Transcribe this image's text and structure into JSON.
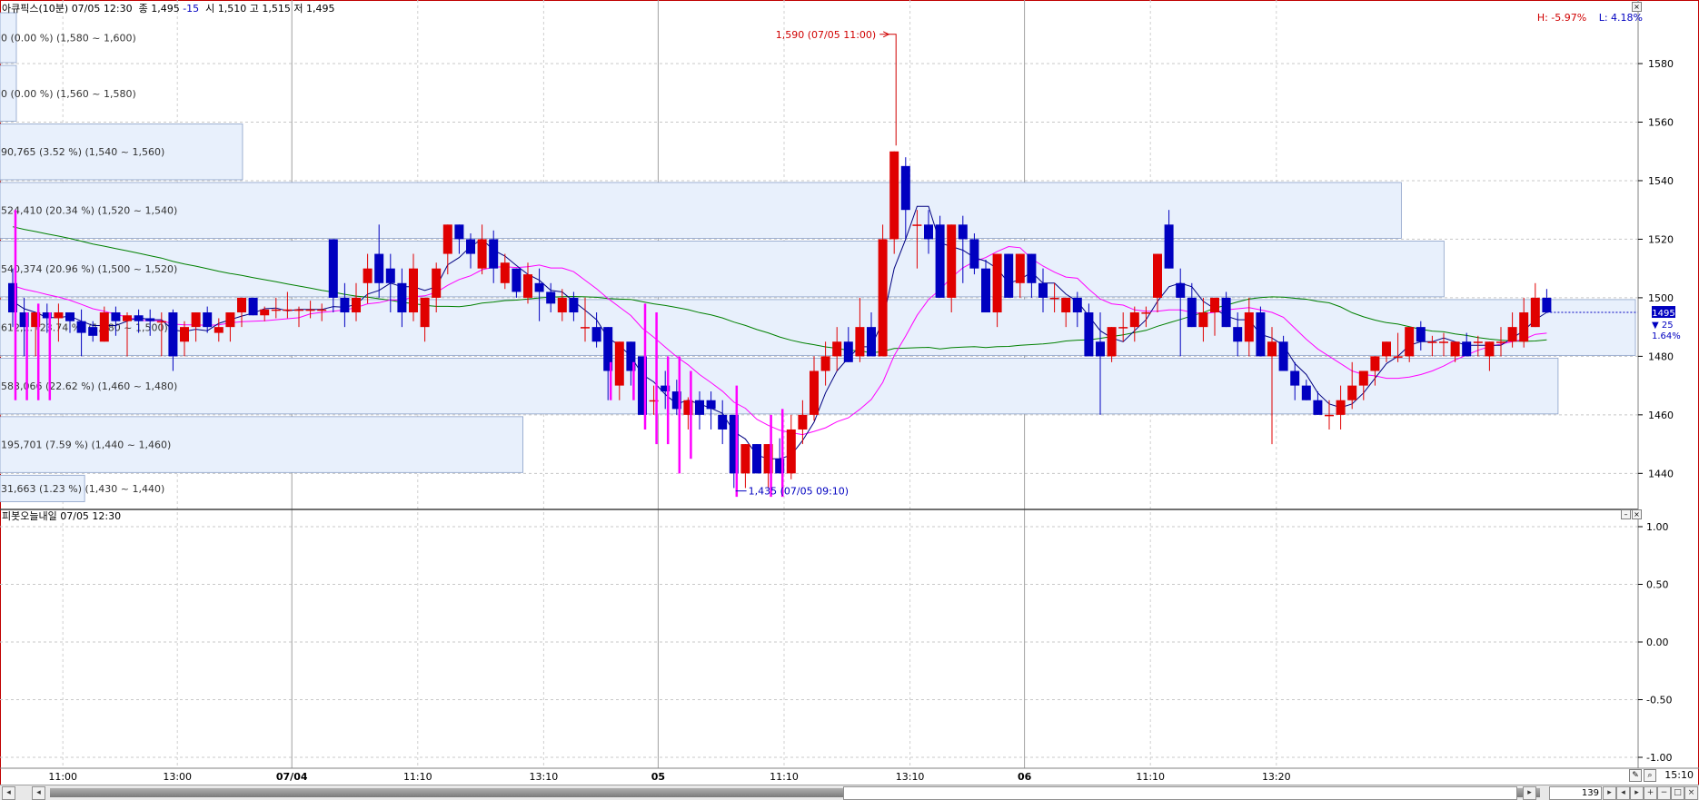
{
  "header": {
    "symbol": "아큐픽스(10분)",
    "datetime": "07/05 12:30",
    "close_label": "종 1,495",
    "change": "-15",
    "ohl": "시 1,510 고 1,515 저 1,495"
  },
  "hilo": {
    "high": "H: -5.97%",
    "low": "L: 4.18%"
  },
  "indicator": {
    "title": "피봇오늘내일",
    "datetime": "07/05 12:30"
  },
  "annotations": {
    "max_label": "1,590 (07/05 11:00)",
    "min_label": "1,435 (07/05 09:10)"
  },
  "price_axis": {
    "ticks": [
      "1580",
      "1560",
      "1540",
      "1520",
      "1500",
      "1480",
      "1460",
      "1440"
    ],
    "current": "1495",
    "change": "▼ 25",
    "pct": "1.64%"
  },
  "indicator_axis": {
    "ticks": [
      "1.00",
      "0.50",
      "0.00",
      "-0.50",
      "-1.00"
    ]
  },
  "time_axis": {
    "ticks": [
      "11:00",
      "13:00",
      "07/04",
      "11:10",
      "13:10",
      "05",
      "11:10",
      "13:10",
      "06",
      "11:10",
      "13:20"
    ]
  },
  "volume_profile": [
    {
      "label": "0 (0.00 %) (1,580 ~ 1,600)",
      "value": 0
    },
    {
      "label": "0 (0.00 %) (1,560 ~ 1,580)",
      "value": 0
    },
    {
      "label": "90,765 (3.52 %) (1,540 ~ 1,560)",
      "value": 90765
    },
    {
      "label": "524,410 (20.34 %) (1,520 ~ 1,540)",
      "value": 524410
    },
    {
      "label": "540,374 (20.96 %) (1,500 ~ 1,520)",
      "value": 540374
    },
    {
      "label": "612,... (23.74 %) (1,480 ~ 1,500)",
      "value": 612000
    },
    {
      "label": "583,066 (22.62 %) (1,460 ~ 1,480)",
      "value": 583066
    },
    {
      "label": "195,701 (7.59 %) (1,440 ~ 1,460)",
      "value": 195701
    },
    {
      "label": "31,663 (1.23 %) (1,430 ~ 1,440)",
      "value": 31663
    }
  ],
  "bottom": {
    "count": "139",
    "time": "15:10"
  },
  "colors": {
    "up": "#e00000",
    "down": "#0000c0",
    "ma_short": "#000080",
    "ma_mid": "#ff00ff",
    "ma_long": "#008000",
    "profile_fill": "#e8f0fc",
    "profile_border": "#8aa0c8"
  },
  "chart_data": {
    "type": "candlestick",
    "y_range": [
      1428,
      1598
    ],
    "candles": [
      [
        1505,
        1510,
        1490,
        1495
      ],
      [
        1495,
        1500,
        1480,
        1490
      ],
      [
        1490,
        1495,
        1480,
        1495
      ],
      [
        1495,
        1498,
        1488,
        1493
      ],
      [
        1493,
        1498,
        1485,
        1495
      ],
      [
        1495,
        1495,
        1488,
        1492
      ],
      [
        1492,
        1496,
        1480,
        1488
      ],
      [
        1490,
        1492,
        1485,
        1487
      ],
      [
        1485,
        1497,
        1485,
        1495
      ],
      [
        1495,
        1497,
        1487,
        1492
      ],
      [
        1492,
        1495,
        1480,
        1494
      ],
      [
        1494,
        1496,
        1488,
        1492
      ],
      [
        1493,
        1496,
        1487,
        1492
      ],
      [
        1492,
        1495,
        1480,
        1492
      ],
      [
        1495,
        1496,
        1475,
        1480
      ],
      [
        1485,
        1492,
        1480,
        1490
      ],
      [
        1490,
        1495,
        1485,
        1495
      ],
      [
        1495,
        1497,
        1488,
        1490
      ],
      [
        1488,
        1493,
        1485,
        1490
      ],
      [
        1490,
        1495,
        1485,
        1495
      ],
      [
        1495,
        1500,
        1490,
        1500
      ],
      [
        1500,
        1500,
        1494,
        1494
      ],
      [
        1494,
        1497,
        1492,
        1496
      ],
      [
        1496,
        1500,
        1493,
        1496
      ],
      [
        1496,
        1502,
        1493,
        1496
      ],
      [
        1496,
        1497,
        1490,
        1496
      ],
      [
        1496,
        1499,
        1493,
        1496
      ],
      [
        1496,
        1498,
        1492,
        1496
      ],
      [
        1520,
        1520,
        1495,
        1500
      ],
      [
        1500,
        1505,
        1490,
        1495
      ],
      [
        1495,
        1505,
        1492,
        1500
      ],
      [
        1505,
        1515,
        1498,
        1510
      ],
      [
        1515,
        1525,
        1500,
        1505
      ],
      [
        1510,
        1515,
        1495,
        1505
      ],
      [
        1505,
        1510,
        1490,
        1495
      ],
      [
        1495,
        1515,
        1492,
        1510
      ],
      [
        1490,
        1500,
        1485,
        1500
      ],
      [
        1500,
        1512,
        1495,
        1510
      ],
      [
        1515,
        1525,
        1508,
        1525
      ],
      [
        1525,
        1525,
        1515,
        1520
      ],
      [
        1520,
        1522,
        1510,
        1515
      ],
      [
        1510,
        1525,
        1508,
        1520
      ],
      [
        1520,
        1523,
        1505,
        1510
      ],
      [
        1505,
        1515,
        1503,
        1512
      ],
      [
        1510,
        1510,
        1500,
        1502
      ],
      [
        1500,
        1512,
        1498,
        1508
      ],
      [
        1505,
        1510,
        1492,
        1502
      ],
      [
        1502,
        1505,
        1495,
        1498
      ],
      [
        1495,
        1503,
        1492,
        1500
      ],
      [
        1500,
        1502,
        1492,
        1495
      ],
      [
        1490,
        1500,
        1485,
        1490
      ],
      [
        1490,
        1495,
        1483,
        1485
      ],
      [
        1490,
        1490,
        1465,
        1475
      ],
      [
        1470,
        1485,
        1465,
        1485
      ],
      [
        1485,
        1485,
        1470,
        1475
      ],
      [
        1480,
        1480,
        1460,
        1460
      ],
      [
        1465,
        1470,
        1460,
        1465
      ],
      [
        1470,
        1475,
        1462,
        1468
      ],
      [
        1468,
        1472,
        1460,
        1462
      ],
      [
        1460,
        1466,
        1455,
        1465
      ],
      [
        1465,
        1468,
        1455,
        1460
      ],
      [
        1465,
        1468,
        1455,
        1462
      ],
      [
        1460,
        1465,
        1450,
        1455
      ],
      [
        1460,
        1460,
        1435,
        1440
      ],
      [
        1440,
        1450,
        1435,
        1450
      ],
      [
        1450,
        1450,
        1440,
        1440
      ],
      [
        1440,
        1450,
        1435,
        1450
      ],
      [
        1445,
        1452,
        1440,
        1440
      ],
      [
        1440,
        1460,
        1438,
        1455
      ],
      [
        1455,
        1465,
        1450,
        1460
      ],
      [
        1460,
        1480,
        1458,
        1475
      ],
      [
        1475,
        1485,
        1470,
        1480
      ],
      [
        1480,
        1490,
        1475,
        1485
      ],
      [
        1485,
        1490,
        1478,
        1478
      ],
      [
        1480,
        1500,
        1478,
        1490
      ],
      [
        1490,
        1495,
        1480,
        1480
      ],
      [
        1480,
        1525,
        1480,
        1520
      ],
      [
        1520,
        1550,
        1515,
        1550
      ],
      [
        1545,
        1548,
        1520,
        1530
      ],
      [
        1525,
        1530,
        1510,
        1525
      ],
      [
        1525,
        1530,
        1515,
        1520
      ],
      [
        1525,
        1528,
        1500,
        1500
      ],
      [
        1500,
        1525,
        1495,
        1525
      ],
      [
        1525,
        1528,
        1505,
        1520
      ],
      [
        1520,
        1522,
        1508,
        1510
      ],
      [
        1510,
        1513,
        1495,
        1495
      ],
      [
        1495,
        1515,
        1490,
        1515
      ],
      [
        1515,
        1515,
        1500,
        1500
      ],
      [
        1505,
        1515,
        1500,
        1515
      ],
      [
        1515,
        1515,
        1500,
        1505
      ],
      [
        1505,
        1510,
        1495,
        1500
      ],
      [
        1500,
        1505,
        1495,
        1500
      ],
      [
        1495,
        1500,
        1490,
        1500
      ],
      [
        1500,
        1502,
        1490,
        1495
      ],
      [
        1495,
        1498,
        1480,
        1480
      ],
      [
        1485,
        1495,
        1460,
        1480
      ],
      [
        1480,
        1490,
        1478,
        1490
      ],
      [
        1490,
        1495,
        1485,
        1490
      ],
      [
        1490,
        1497,
        1485,
        1495
      ],
      [
        1495,
        1497,
        1490,
        1495
      ],
      [
        1500,
        1515,
        1495,
        1515
      ],
      [
        1525,
        1530,
        1510,
        1510
      ],
      [
        1505,
        1510,
        1480,
        1500
      ],
      [
        1500,
        1505,
        1490,
        1490
      ],
      [
        1490,
        1500,
        1485,
        1495
      ],
      [
        1495,
        1500,
        1487,
        1500
      ],
      [
        1500,
        1502,
        1490,
        1490
      ],
      [
        1490,
        1495,
        1480,
        1485
      ],
      [
        1485,
        1500,
        1480,
        1495
      ],
      [
        1495,
        1497,
        1480,
        1480
      ],
      [
        1480,
        1490,
        1450,
        1485
      ],
      [
        1485,
        1487,
        1475,
        1475
      ],
      [
        1475,
        1478,
        1465,
        1470
      ],
      [
        1470,
        1472,
        1465,
        1465
      ],
      [
        1465,
        1468,
        1460,
        1460
      ],
      [
        1460,
        1465,
        1455,
        1460
      ],
      [
        1460,
        1470,
        1455,
        1465
      ],
      [
        1465,
        1478,
        1462,
        1470
      ],
      [
        1470,
        1475,
        1465,
        1475
      ],
      [
        1475,
        1480,
        1470,
        1480
      ],
      [
        1480,
        1485,
        1478,
        1485
      ],
      [
        1480,
        1488,
        1478,
        1480
      ],
      [
        1480,
        1490,
        1478,
        1490
      ],
      [
        1490,
        1492,
        1482,
        1485
      ],
      [
        1485,
        1487,
        1480,
        1485
      ],
      [
        1485,
        1488,
        1480,
        1485
      ],
      [
        1480,
        1485,
        1478,
        1485
      ],
      [
        1485,
        1488,
        1480,
        1480
      ],
      [
        1485,
        1487,
        1480,
        1485
      ],
      [
        1480,
        1485,
        1475,
        1485
      ],
      [
        1485,
        1490,
        1480,
        1485
      ],
      [
        1485,
        1495,
        1483,
        1490
      ],
      [
        1485,
        1500,
        1483,
        1495
      ],
      [
        1490,
        1505,
        1490,
        1500
      ],
      [
        1500,
        1503,
        1495,
        1495
      ]
    ]
  }
}
